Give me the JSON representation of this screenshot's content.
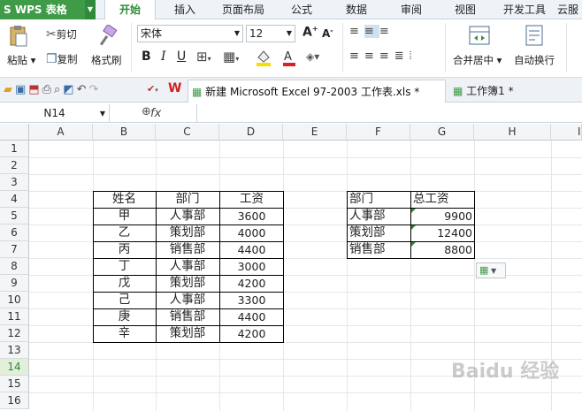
{
  "app": {
    "name": "WPS 表格"
  },
  "menu": [
    "开始",
    "插入",
    "页面布局",
    "公式",
    "数据",
    "审阅",
    "视图",
    "开发工具",
    "云服"
  ],
  "ribbon": {
    "paste": "粘贴",
    "cut": "剪切",
    "copy": "复制",
    "format_painter": "格式刷",
    "font_name": "宋体",
    "font_size": "12",
    "merge_center": "合并居中",
    "wrap_text": "自动换行",
    "bold": "B",
    "italic": "I",
    "underline": "U"
  },
  "tabs": [
    {
      "label": "新建 Microsoft Excel 97-2003 工作表.xls *"
    },
    {
      "label": "工作簿1 *"
    }
  ],
  "formula_bar": {
    "name_box": "N14",
    "fx": "fx",
    "value": ""
  },
  "columns": [
    "A",
    "B",
    "C",
    "D",
    "E",
    "F",
    "G",
    "H",
    "I"
  ],
  "rows": [
    "1",
    "2",
    "3",
    "4",
    "5",
    "6",
    "7",
    "8",
    "9",
    "10",
    "11",
    "12",
    "13",
    "14",
    "15",
    "16"
  ],
  "table1": {
    "headers": [
      "姓名",
      "部门",
      "工资"
    ],
    "rows": [
      [
        "甲",
        "人事部",
        "3600"
      ],
      [
        "乙",
        "策划部",
        "4000"
      ],
      [
        "丙",
        "销售部",
        "4400"
      ],
      [
        "丁",
        "人事部",
        "3000"
      ],
      [
        "戊",
        "策划部",
        "4200"
      ],
      [
        "己",
        "人事部",
        "3300"
      ],
      [
        "庚",
        "销售部",
        "4400"
      ],
      [
        "辛",
        "策划部",
        "4200"
      ]
    ]
  },
  "table2": {
    "headers": [
      "部门",
      "总工资"
    ],
    "rows": [
      [
        "人事部",
        "9900"
      ],
      [
        "策划部",
        "12400"
      ],
      [
        "销售部",
        "8800"
      ]
    ]
  },
  "watermark": "Baidu 经验",
  "colors": {
    "accent": "#3f9b48",
    "active_tab": "#2f8a39"
  }
}
